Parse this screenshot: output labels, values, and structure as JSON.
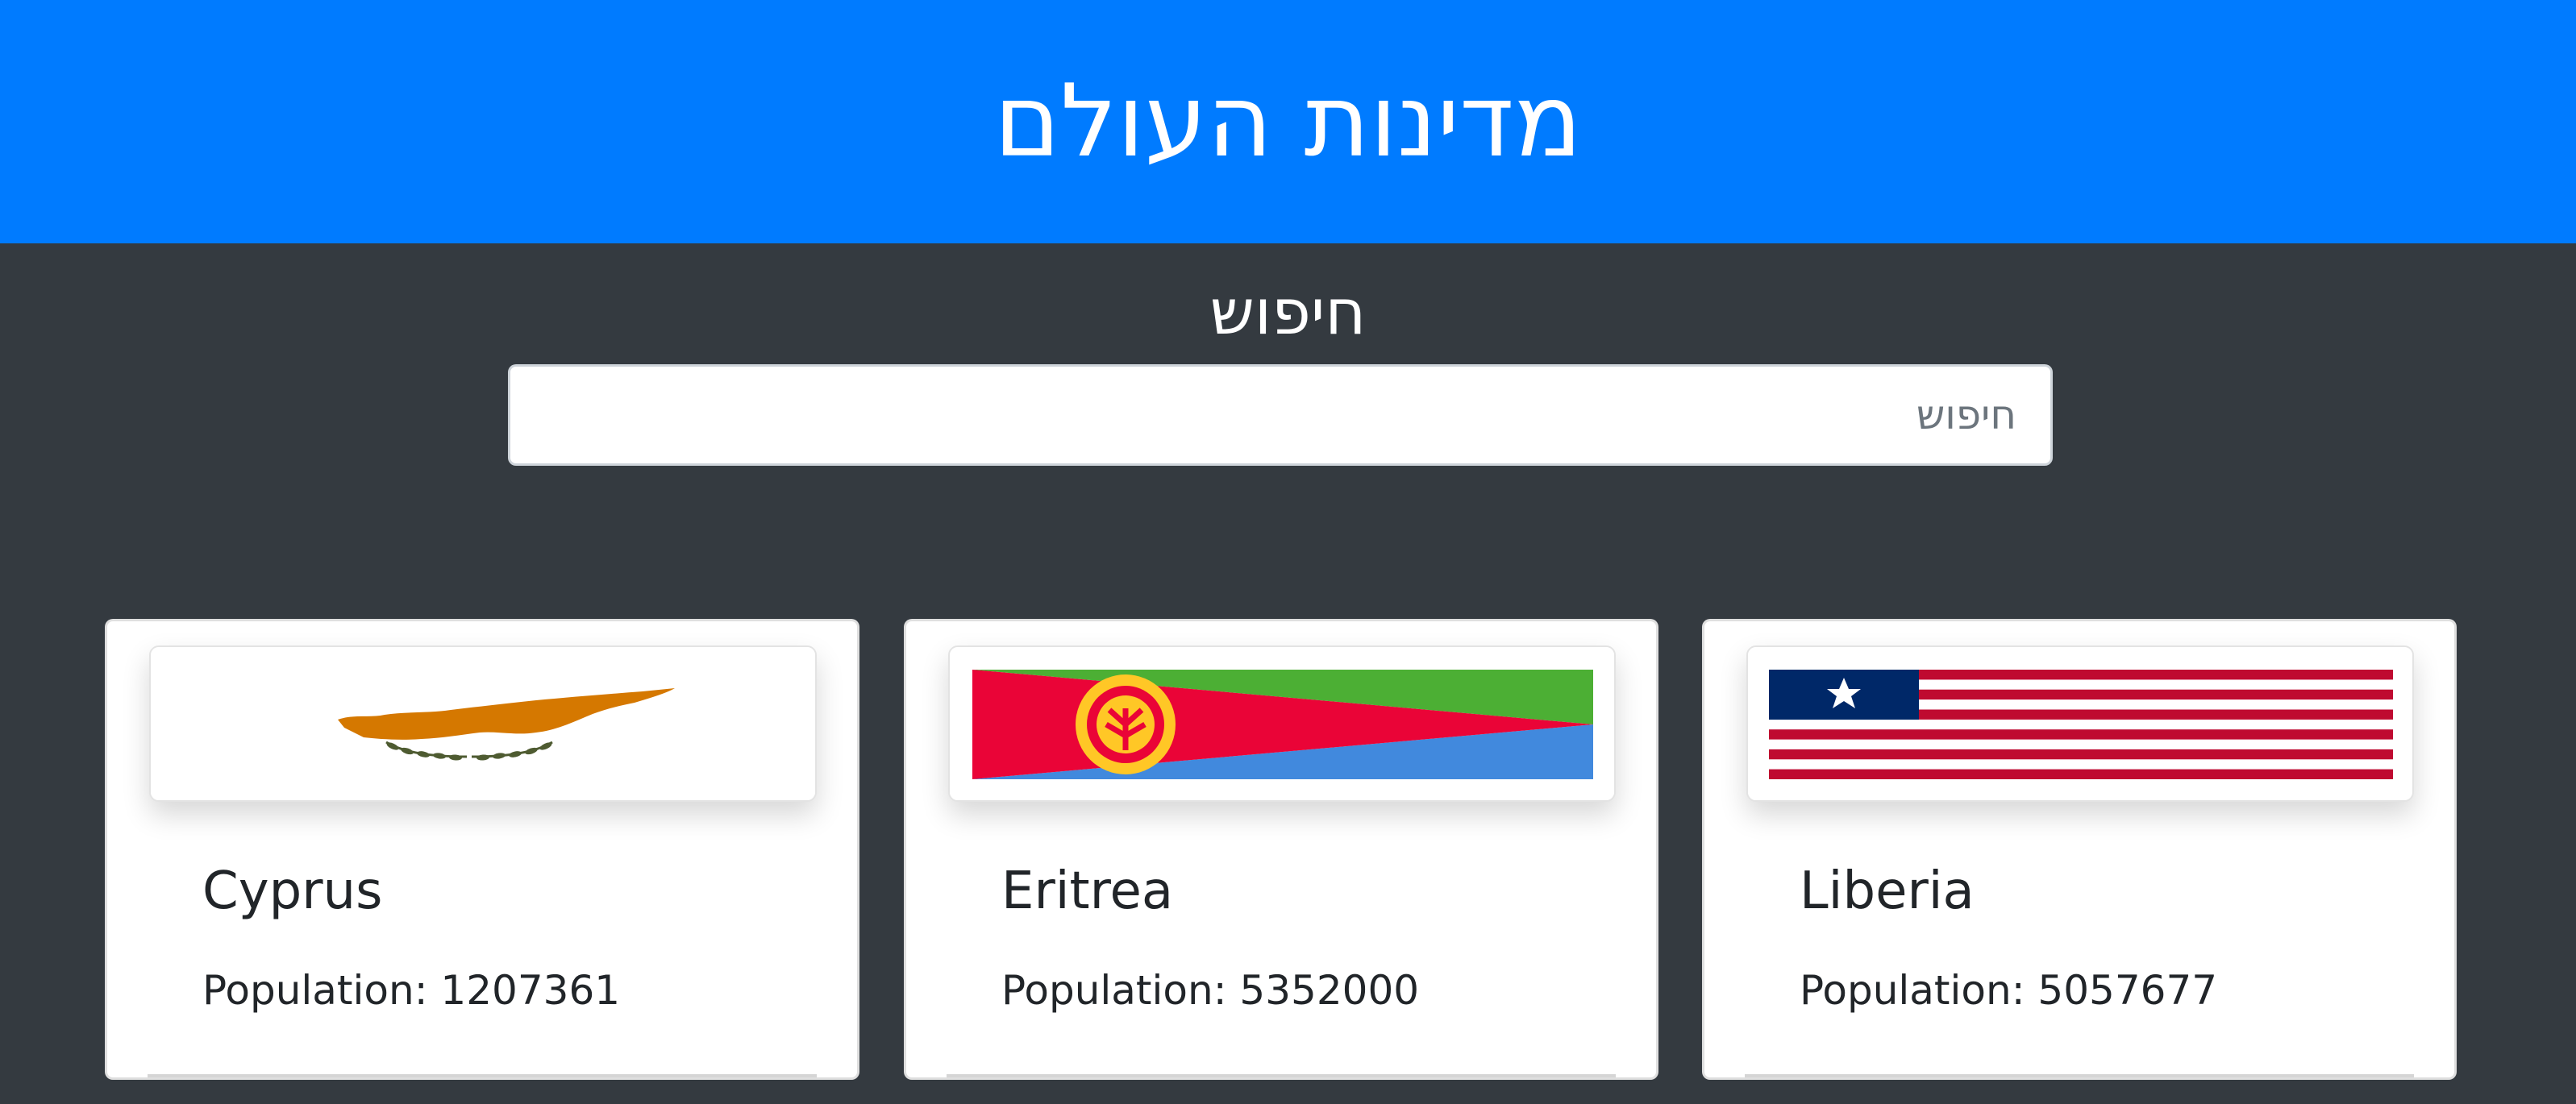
{
  "header": {
    "title": "מדינות העולם"
  },
  "search": {
    "label": "חיפוש",
    "placeholder": "חיפוש",
    "value": ""
  },
  "countries": [
    {
      "name": "Cyprus",
      "population_label": "Population: 1207361",
      "population": 1207361,
      "flag_icon": "cyprus-flag"
    },
    {
      "name": "Eritrea",
      "population_label": "Population: 5352000",
      "population": 5352000,
      "flag_icon": "eritrea-flag"
    },
    {
      "name": "Liberia",
      "population_label": "Population: 5057677",
      "population": 5057677,
      "flag_icon": "liberia-flag"
    }
  ],
  "colors": {
    "header_bg": "#007bff",
    "page_bg": "#343a40",
    "card_bg": "#ffffff",
    "text": "#212529"
  }
}
